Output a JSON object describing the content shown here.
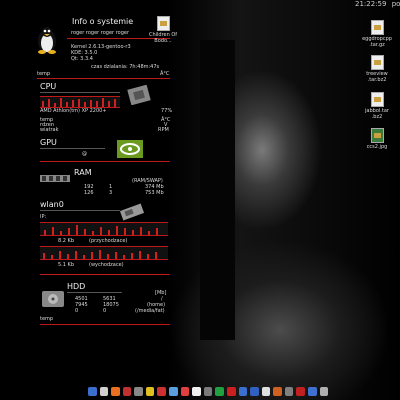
{
  "clock": {
    "time": "21:22:59",
    "day": "poni"
  },
  "info": {
    "title": "Info o systemie",
    "users": "roger roger roger roger",
    "kernel": "Kernel 2.6.13-gentoo-r3",
    "kde": "KDE: 3.5.0",
    "qt": "Qt: 3.3.4",
    "uptime": "czas dzialania: 7h:48m:47s",
    "temp_label": "temp",
    "temp_unit": "Â°C"
  },
  "cpu": {
    "title": "CPU",
    "model": "AMD Athlon(tm) XP 2200+",
    "usage": "77%",
    "temp_label": "temp",
    "core_label": "rdzen",
    "fan_label": "wiatrak",
    "temp_unit": "Â°C",
    "fan_unit": "V",
    "rpm_unit": "RPM"
  },
  "gpu": {
    "title": "GPU",
    "temp_symbol": "@"
  },
  "ram": {
    "title": "RAM",
    "header": "(RAM/SWAP)",
    "row1_a": "192",
    "row1_b": "1",
    "row1_total": "374 Mb",
    "row2_a": "126",
    "row2_b": "3",
    "row2_total": "753 Mb"
  },
  "wlan": {
    "title": "wlan0",
    "ip_label": "IP:",
    "down_rate": "8.2 Kb",
    "down_label": "(przychodzace)",
    "up_rate": "5.1 Kb",
    "up_label": "(wychodzace)"
  },
  "hdd": {
    "title": "HDD",
    "unit": "[Mb]",
    "r1a": "4501",
    "r1b": "5631",
    "r1c": "/",
    "r2a": "7945",
    "r2b": "18075",
    "r2c": "(home)",
    "r3a": "0",
    "r3b": "0",
    "r3c": "(/media/fat)",
    "temp_label": "temp"
  },
  "desktop_icons": {
    "children": "Children Of Bodo...",
    "f1": "eggdropcpp .tar.gz",
    "f2": "treeview .tar.bz2",
    "f3": "jabbol.tar .bz2",
    "f4": "ccs2.jpg"
  },
  "taskbar_colors": [
    "#3a6fd0",
    "#d0d0d0",
    "#e87020",
    "#c03030",
    "#888888",
    "#e0c020",
    "#cc3030",
    "#5aa0e0",
    "#e04040",
    "#f0f0f0",
    "#7a7a7a",
    "#20a040",
    "#cc2020",
    "#3a6fd0",
    "#3060c0",
    "#e0e0e0",
    "#d06020",
    "#808080",
    "#c02020",
    "#4070d0",
    "#b0b0b0"
  ]
}
